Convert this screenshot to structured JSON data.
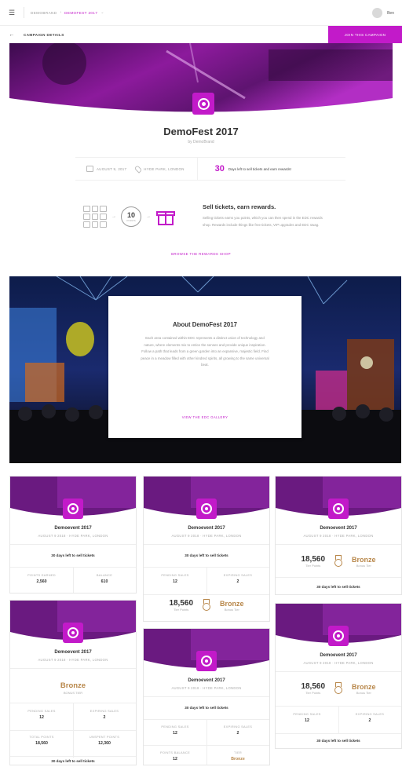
{
  "header": {
    "breadcrumb": [
      "DemoBrand",
      "DemoFest 2017"
    ],
    "user_name": "Ben"
  },
  "subheader": {
    "title": "Campaign Details",
    "join_label": "Join this campaign"
  },
  "campaign": {
    "title": "DemoFest 2017",
    "byline": "by DemoBrand",
    "date": "August 9, 2017",
    "location": "Hyde Park, London",
    "days_count": "30",
    "days_text": "Days left to sell tickets and earn rewards!"
  },
  "rewards": {
    "points_value": "10",
    "points_label": "Points",
    "heading": "Sell tickets, earn rewards.",
    "body": "Selling tickets earns you points, which you can then spend in the EDC rewards shop. Rewards include things like free tickets, VIP upgrades and EDC swag.",
    "browse_label": "Browse the rewards shop"
  },
  "about": {
    "title": "About DemoFest 2017",
    "body": "Each area contained within EDC represents a distinct union of technology and nature, where elements mix to entice the senses and provide unique inspiration. Follow a path that leads from a green garden into an expansive, majestic field. Find peace in a meadow filled with other kindred spirits, all growing to the same universal beat.",
    "gallery_label": "View the EDC gallery"
  },
  "cards": [
    {
      "title": "Demoevent 2017",
      "date": "August 9 2018 · Hyde Park, London",
      "days": "30 days left to sell tickets",
      "stats": [
        {
          "label": "Points earned",
          "value": "2,560"
        },
        {
          "label": "Balance",
          "value": "610"
        }
      ]
    },
    {
      "title": "Demoevent 2017",
      "date": "August 9 2018 · Hyde Park, London",
      "days": "30 days left to sell tickets",
      "stats": [
        {
          "label": "Pending sales",
          "value": "12"
        },
        {
          "label": "Expiring sales",
          "value": "2"
        }
      ],
      "tier_points": "18,560",
      "tier_points_label": "Tier Points",
      "tier": "Bronze",
      "tier_label": "Bonus Tier"
    },
    {
      "title": "Demoevent 2017",
      "date": "August 9 2018 · Hyde Park, London",
      "tier_points": "18,560",
      "tier_points_label": "Tier Points",
      "tier": "Bronze",
      "tier_label": "Bonus Tier",
      "days": "30 days left to sell tickets"
    },
    {
      "title": "Demoevent 2017",
      "date": "August 9 2018 · Hyde Park, London",
      "tier": "Bronze",
      "tier_label": "Bonus Tier",
      "stats": [
        {
          "label": "Pending sales",
          "value": "12"
        },
        {
          "label": "Expiring sales",
          "value": "2"
        },
        {
          "label": "Total points",
          "value": "18,560"
        },
        {
          "label": "Unspent points",
          "value": "12,360"
        }
      ],
      "days": "30 days left to sell tickets"
    },
    {
      "title": "Demoevent 2017",
      "date": "August 9 2018 · Hyde Park, London",
      "days": "30 days left to sell tickets",
      "stats": [
        {
          "label": "Pending sales",
          "value": "12"
        },
        {
          "label": "Expiring sales",
          "value": "2"
        },
        {
          "label": "Points balance",
          "value": "12"
        },
        {
          "label": "Tier",
          "value": "Bronze"
        }
      ]
    },
    {
      "title": "Demoevent 2017",
      "date": "August 9 2018 · Hyde Park, London",
      "tier_points": "18,560",
      "tier_points_label": "Tier Points",
      "tier": "Bronze",
      "tier_label": "Bonus Tier",
      "stats": [
        {
          "label": "Pending sales",
          "value": "12"
        },
        {
          "label": "Expiring sales",
          "value": "2"
        }
      ],
      "days": "30 days left to sell tickets"
    }
  ],
  "colors": {
    "accent": "#c21ac9",
    "bronze": "#b8874a",
    "hero_purple": "#5e1470"
  }
}
